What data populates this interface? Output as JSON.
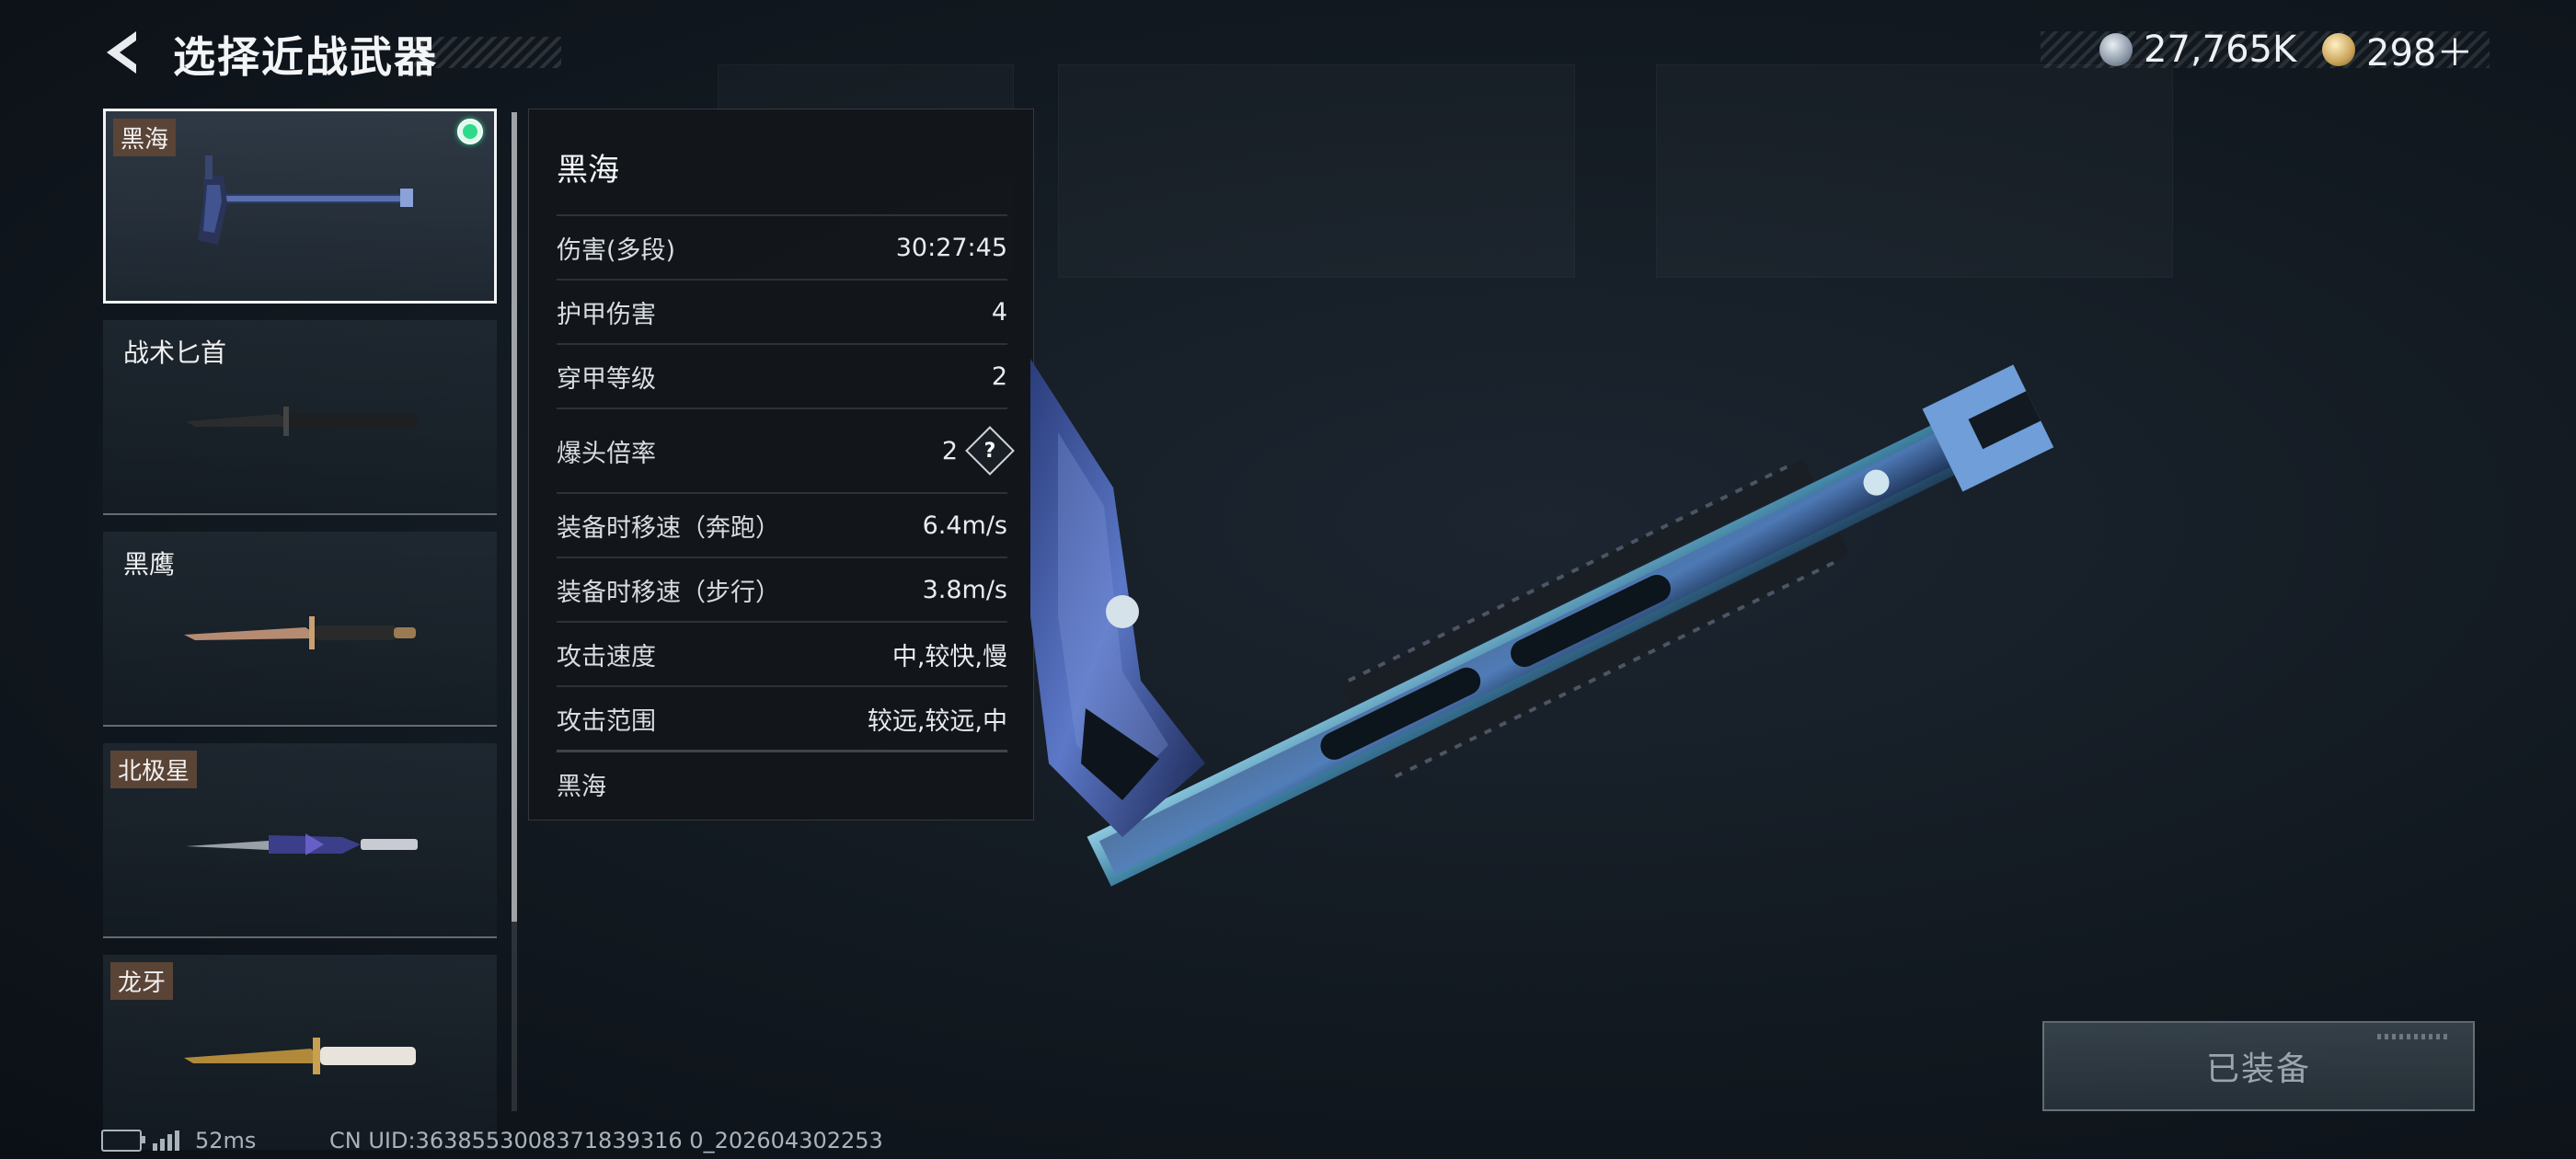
{
  "header": {
    "title": "选择近战武器",
    "currency": [
      {
        "icon": "silver-coin-icon",
        "value": "27,765K"
      },
      {
        "icon": "gold-coin-icon",
        "value": "298＋"
      }
    ]
  },
  "weapons": [
    {
      "name": "黑海",
      "selected": true,
      "equipped": true
    },
    {
      "name": "战术匕首",
      "selected": false
    },
    {
      "name": "黑鹰",
      "selected": false
    },
    {
      "name": "北极星",
      "selected": false
    },
    {
      "name": "龙牙",
      "selected": false
    }
  ],
  "stats": {
    "name": "黑海",
    "rows": [
      {
        "label": "伤害(多段)",
        "value": "30:27:45"
      },
      {
        "label": "护甲伤害",
        "value": "4"
      },
      {
        "label": "穿甲等级",
        "value": "2"
      },
      {
        "label": "爆头倍率",
        "value": "2",
        "help": "?"
      },
      {
        "label": "装备时移速（奔跑）",
        "value": "6.4m/s"
      },
      {
        "label": "装备时移速（步行）",
        "value": "3.8m/s"
      },
      {
        "label": "攻击速度",
        "value": "中,较快,慢"
      },
      {
        "label": "攻击范围",
        "value": "较远,较远,中"
      }
    ],
    "footer": "黑海"
  },
  "equip_button": {
    "label": "已装备"
  },
  "status": {
    "ping": "52ms",
    "uid": "CN UID:3638553008371839316 0_202604302253"
  }
}
